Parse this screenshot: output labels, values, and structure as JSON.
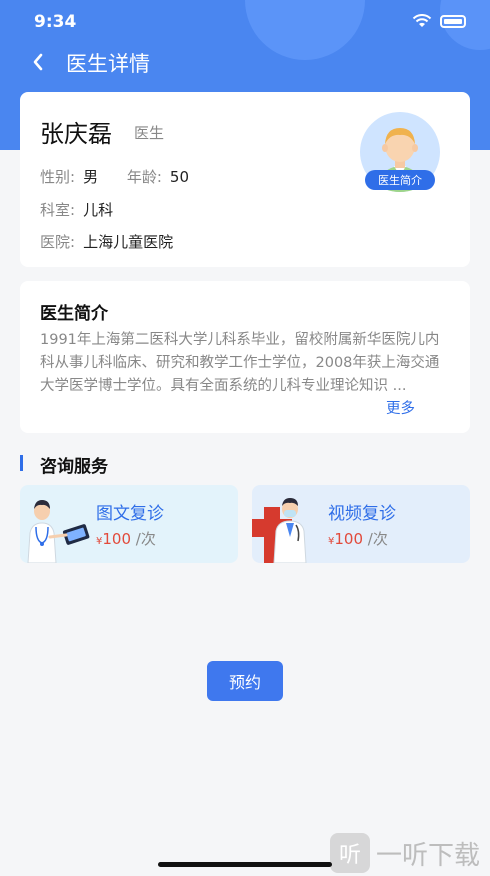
{
  "status_bar": {
    "time": "9:34",
    "icons": [
      "wifi-icon",
      "battery-icon"
    ]
  },
  "nav": {
    "back_icon": "chevron-left-icon",
    "title": "医生详情"
  },
  "doctor": {
    "name": "张庆磊",
    "role": "医生",
    "gender_label": "性别:",
    "gender": "男",
    "age_label": "年龄:",
    "age": "50",
    "dept_label": "科室:",
    "dept": "儿科",
    "hospital_label": "医院:",
    "hospital": "上海儿童医院",
    "avatar_badge": "医生简介"
  },
  "intro": {
    "title": "医生简介",
    "text": "1991年上海第二医科大学儿科系毕业，留校附属新华医院儿内科从事儿科临床、研究和教学工作士学位，2008年获上海交通大学医学博士学位。具有全面系统的儿科专业理论知识 ...",
    "more": "更多"
  },
  "services": {
    "title": "咨询服务",
    "items": [
      {
        "name": "图文复诊",
        "currency": "¥",
        "price": "100",
        "unit": "/次"
      },
      {
        "name": "视频复诊",
        "currency": "¥",
        "price": "100",
        "unit": "/次"
      }
    ]
  },
  "book_button": "预约",
  "watermark": {
    "logo": "听",
    "text": "一听下载"
  },
  "colors": {
    "primary": "#4a86f0",
    "accent": "#2f6ee8",
    "price": "#e24a3b",
    "background": "#f5f6f8"
  }
}
